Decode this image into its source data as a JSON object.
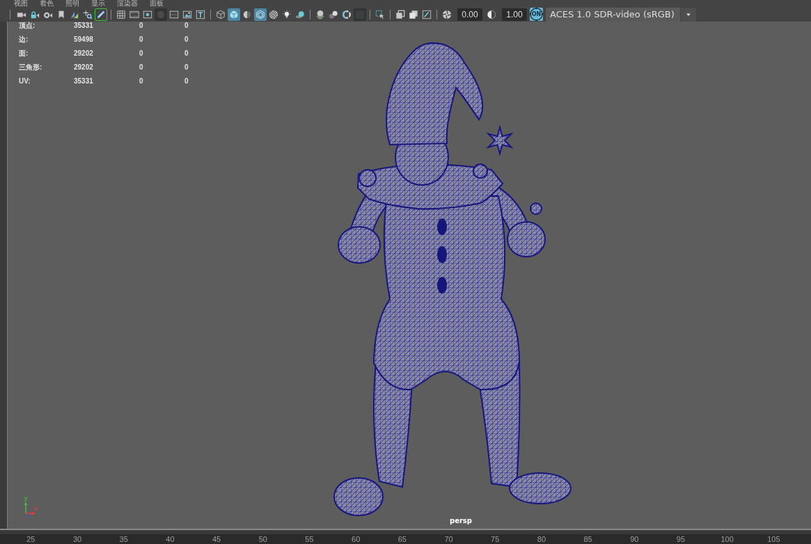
{
  "menu": [
    {
      "label": "视图"
    },
    {
      "label": "着色"
    },
    {
      "label": "照明"
    },
    {
      "label": "显示"
    },
    {
      "label": "渲染器"
    },
    {
      "label": "面板"
    }
  ],
  "toolbar": {
    "groups": [
      {
        "kind": "tools",
        "buttons": [
          {
            "selected": false,
            "disabled": false
          },
          {
            "selected": false,
            "disabled": false
          },
          {
            "selected": false,
            "disabled": false
          },
          {
            "selected": false,
            "disabled": false
          },
          {
            "selected": false,
            "disabled": false
          },
          {
            "selected": false,
            "disabled": false
          },
          {
            "selected": true,
            "disabled": false
          }
        ]
      },
      {
        "kind": "display",
        "buttons": [
          {
            "selected": false,
            "disabled": false
          },
          {
            "selected": false,
            "disabled": false
          },
          {
            "selected": false,
            "disabled": false
          },
          {
            "selected": false,
            "disabled": true
          },
          {
            "selected": false,
            "disabled": false
          },
          {
            "selected": false,
            "disabled": false
          },
          {
            "selected": false,
            "disabled": false
          }
        ]
      },
      {
        "kind": "display",
        "buttons": [
          {
            "selected": false,
            "disabled": false
          },
          {
            "selected": true,
            "disabled": false
          },
          {
            "selected": false,
            "disabled": false
          },
          {
            "selected": true,
            "disabled": false
          },
          {
            "selected": false,
            "disabled": false
          },
          {
            "selected": false,
            "disabled": false
          },
          {
            "selected": false,
            "disabled": false
          }
        ]
      },
      {
        "kind": "display",
        "buttons": [
          {
            "selected": false,
            "disabled": false
          },
          {
            "selected": false,
            "disabled": false
          },
          {
            "selected": false,
            "disabled": false
          },
          {
            "selected": false,
            "disabled": true
          }
        ]
      },
      {
        "kind": "display",
        "buttons": [
          {
            "selected": false,
            "disabled": false
          }
        ]
      },
      {
        "kind": "display",
        "buttons": [
          {
            "selected": false,
            "disabled": false
          },
          {
            "selected": false,
            "disabled": false
          },
          {
            "selected": false,
            "disabled": false
          }
        ]
      }
    ],
    "exposure": {
      "value": "0.00"
    },
    "gamma": {
      "value": "1.00"
    },
    "color_management": {
      "label": "ON",
      "selected": true
    },
    "view_transform": {
      "value": "ACES 1.0 SDR-video (sRGB)"
    }
  },
  "stats": [
    {
      "label": "顶点:",
      "values": [
        "35331",
        "0",
        "0"
      ]
    },
    {
      "label": "边:",
      "values": [
        "59498",
        "0",
        "0"
      ]
    },
    {
      "label": "面:",
      "values": [
        "29202",
        "0",
        "0"
      ]
    },
    {
      "label": "三角形:",
      "values": [
        "29202",
        "0",
        "0"
      ]
    },
    {
      "label": "UV:",
      "values": [
        "35331",
        "0",
        "0"
      ]
    }
  ],
  "viewport": {
    "camera": "persp",
    "axes": [
      {
        "label": "y",
        "color": "#45c045"
      },
      {
        "label": "x",
        "color": "#e04040"
      }
    ]
  },
  "timeline": {
    "ticks": [
      "25",
      "30",
      "35",
      "40",
      "45",
      "50",
      "55",
      "60",
      "65",
      "70",
      "75",
      "80",
      "85",
      "90",
      "95",
      "100",
      "105"
    ]
  }
}
